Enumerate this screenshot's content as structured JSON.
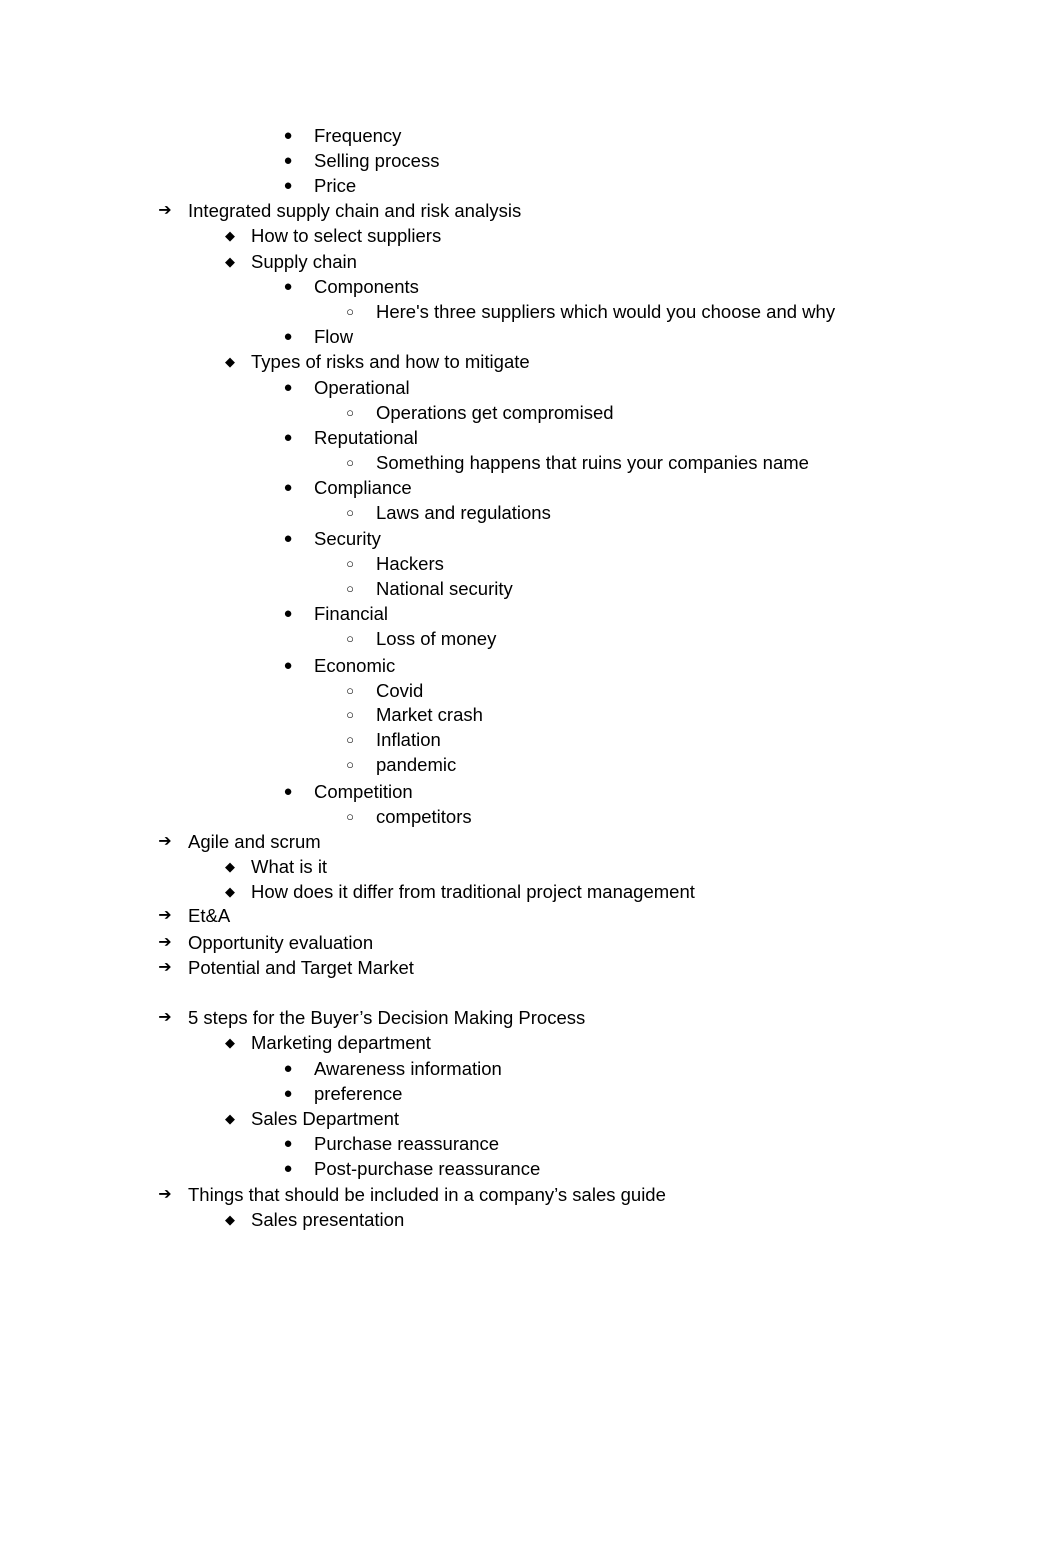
{
  "document": {
    "lines": [
      {
        "level": 2,
        "marker": "●",
        "marker_icon": "filled-circle-bullet-icon",
        "text": "Frequency"
      },
      {
        "level": 2,
        "marker": "●",
        "marker_icon": "filled-circle-bullet-icon",
        "text": "Selling process"
      },
      {
        "level": 2,
        "marker": "●",
        "marker_icon": "filled-circle-bullet-icon",
        "text": "Price"
      },
      {
        "level": 0,
        "marker": "➔",
        "marker_icon": "arrow-bullet-icon",
        "text": "Integrated supply chain and risk analysis"
      },
      {
        "level": 1,
        "marker": "◆",
        "marker_icon": "diamond-bullet-icon",
        "text": "How to select suppliers"
      },
      {
        "level": 1,
        "marker": "◆",
        "marker_icon": "diamond-bullet-icon",
        "text": "Supply chain"
      },
      {
        "level": 2,
        "marker": "●",
        "marker_icon": "filled-circle-bullet-icon",
        "text": "Components"
      },
      {
        "level": 3,
        "marker": "○",
        "marker_icon": "hollow-circle-bullet-icon",
        "text": "Here's three suppliers which would you choose and why"
      },
      {
        "level": 2,
        "marker": "●",
        "marker_icon": "filled-circle-bullet-icon",
        "text": "Flow"
      },
      {
        "level": 1,
        "marker": "◆",
        "marker_icon": "diamond-bullet-icon",
        "text": "Types of risks and how to mitigate"
      },
      {
        "level": 2,
        "marker": "●",
        "marker_icon": "filled-circle-bullet-icon",
        "text": "Operational"
      },
      {
        "level": 3,
        "marker": "○",
        "marker_icon": "hollow-circle-bullet-icon",
        "text": "Operations get compromised"
      },
      {
        "level": 2,
        "marker": "●",
        "marker_icon": "filled-circle-bullet-icon",
        "text": "Reputational"
      },
      {
        "level": 3,
        "marker": "○",
        "marker_icon": "hollow-circle-bullet-icon",
        "text": "Something happens that ruins your companies name"
      },
      {
        "level": 2,
        "marker": "●",
        "marker_icon": "filled-circle-bullet-icon",
        "text": "Compliance"
      },
      {
        "level": 3,
        "marker": "○",
        "marker_icon": "hollow-circle-bullet-icon",
        "text": "Laws and regulations"
      },
      {
        "level": 2,
        "marker": "●",
        "marker_icon": "filled-circle-bullet-icon",
        "text": "Security"
      },
      {
        "level": 3,
        "marker": "○",
        "marker_icon": "hollow-circle-bullet-icon",
        "text": "Hackers"
      },
      {
        "level": 3,
        "marker": "○",
        "marker_icon": "hollow-circle-bullet-icon",
        "text": "National security"
      },
      {
        "level": 2,
        "marker": "●",
        "marker_icon": "filled-circle-bullet-icon",
        "text": "Financial"
      },
      {
        "level": 3,
        "marker": "○",
        "marker_icon": "hollow-circle-bullet-icon",
        "text": "Loss of money"
      },
      {
        "level": 2,
        "marker": "●",
        "marker_icon": "filled-circle-bullet-icon",
        "text": "Economic"
      },
      {
        "level": 3,
        "marker": "○",
        "marker_icon": "hollow-circle-bullet-icon",
        "text": "Covid"
      },
      {
        "level": 3,
        "marker": "○",
        "marker_icon": "hollow-circle-bullet-icon",
        "text": "Market crash"
      },
      {
        "level": 3,
        "marker": "○",
        "marker_icon": "hollow-circle-bullet-icon",
        "text": "Inflation"
      },
      {
        "level": 3,
        "marker": "○",
        "marker_icon": "hollow-circle-bullet-icon",
        "text": "pandemic"
      },
      {
        "level": 2,
        "marker": "●",
        "marker_icon": "filled-circle-bullet-icon",
        "text": "Competition"
      },
      {
        "level": 3,
        "marker": "○",
        "marker_icon": "hollow-circle-bullet-icon",
        "text": "competitors"
      },
      {
        "level": 0,
        "marker": "➔",
        "marker_icon": "arrow-bullet-icon",
        "text": "Agile and scrum"
      },
      {
        "level": 1,
        "marker": "◆",
        "marker_icon": "diamond-bullet-icon",
        "text": "What is it"
      },
      {
        "level": 1,
        "marker": "◆",
        "marker_icon": "diamond-bullet-icon",
        "text": "How does it differ from traditional project management"
      },
      {
        "level": 0,
        "marker": "➔",
        "marker_icon": "arrow-bullet-icon",
        "text": "Et&A"
      },
      {
        "level": 0,
        "marker": "➔",
        "marker_icon": "arrow-bullet-icon",
        "text": "Opportunity evaluation"
      },
      {
        "level": 0,
        "marker": "➔",
        "marker_icon": "arrow-bullet-icon",
        "text": "Potential and Target Market"
      },
      {
        "level": 0,
        "marker": "➔",
        "marker_icon": "arrow-bullet-icon",
        "text": "5 steps for the Buyer’s Decision Making Process"
      },
      {
        "level": 1,
        "marker": "◆",
        "marker_icon": "diamond-bullet-icon",
        "text": "Marketing department"
      },
      {
        "level": 2,
        "marker": "●",
        "marker_icon": "filled-circle-bullet-icon",
        "text": "Awareness information"
      },
      {
        "level": 2,
        "marker": "●",
        "marker_icon": "filled-circle-bullet-icon",
        "text": "preference"
      },
      {
        "level": 1,
        "marker": "◆",
        "marker_icon": "diamond-bullet-icon",
        "text": "Sales Department"
      },
      {
        "level": 2,
        "marker": "●",
        "marker_icon": "filled-circle-bullet-icon",
        "text": "Purchase reassurance"
      },
      {
        "level": 2,
        "marker": "●",
        "marker_icon": "filled-circle-bullet-icon",
        "text": "Post-purchase reassurance"
      },
      {
        "level": 0,
        "marker": "➔",
        "marker_icon": "arrow-bullet-icon",
        "text": "Things that should be included in a company’s sales guide"
      },
      {
        "level": 1,
        "marker": "◆",
        "marker_icon": "diamond-bullet-icon",
        "text": "Sales presentation"
      }
    ]
  }
}
